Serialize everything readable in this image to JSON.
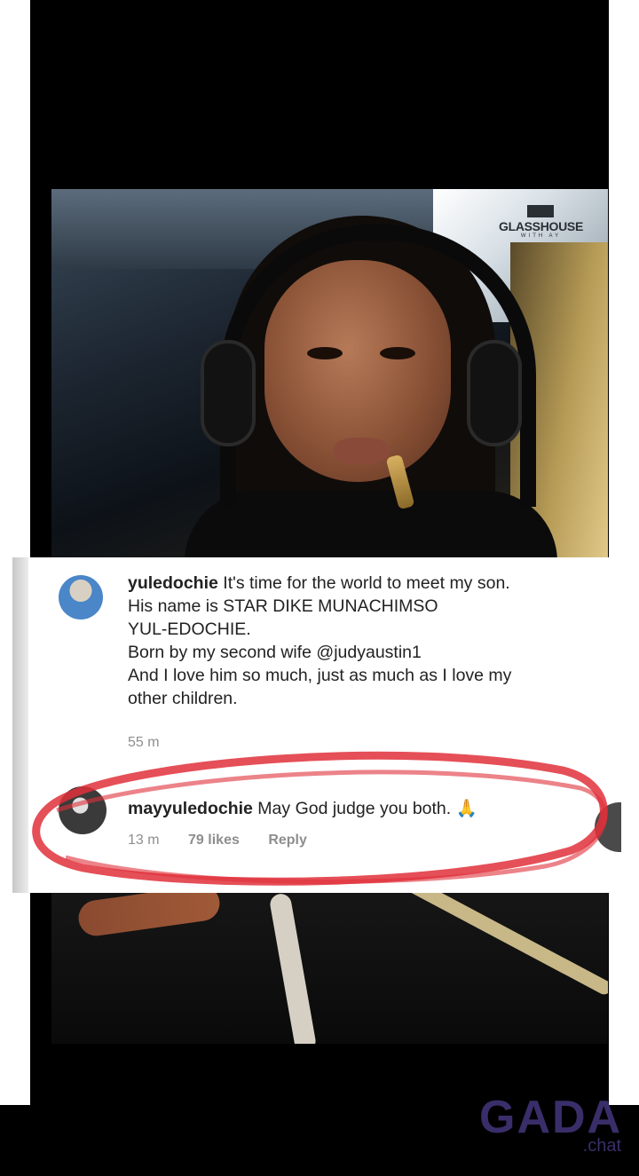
{
  "video_top": {
    "logo_text": "GLASSHOUSE",
    "logo_sub": "WITH AY"
  },
  "comments": [
    {
      "username": "yuledochie",
      "text": " It's time for the world to meet my son. His name is STAR DIKE MUNACHIMSO YUL-EDOCHIE. Born by my second wife @judyaustin1 And I love him so much, just as much as I love my other children.",
      "line1": " It's time for the world to meet my son.",
      "line2": "His name is STAR DIKE MUNACHIMSO",
      "line3": "YUL-EDOCHIE.",
      "line4": "Born by my second wife @judyaustin1",
      "line5": "And I love him so much, just as much as I love my",
      "line6": "other children.",
      "time": "55 m"
    },
    {
      "username": "mayyuledochie",
      "text": " May God judge you both. 🙏",
      "time": "13 m",
      "likes": "79 likes",
      "reply_label": "Reply"
    }
  ],
  "colors": {
    "highlight": "#e0303a",
    "watermark": "#3a2e6a"
  },
  "watermark": {
    "main": "GADA",
    "sub": ".chat"
  }
}
